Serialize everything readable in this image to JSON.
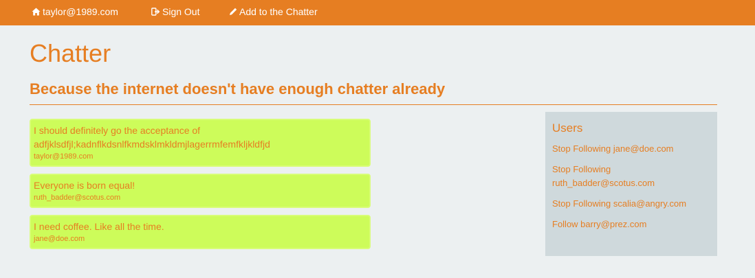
{
  "nav": {
    "home_label": "taylor@1989.com",
    "home_icon": "home-icon",
    "signout_label": "Sign Out",
    "signout_icon": "sign-out-icon",
    "add_label": "Add to the Chatter",
    "add_icon": "pencil-icon",
    "background_color": "#e67e22"
  },
  "header": {
    "title": "Chatter",
    "subtitle": "Because the internet doesn't have enough chatter already"
  },
  "chatters": [
    {
      "text": "I should definitely go the acceptance of adfjklsdfjl;kadnflkdsnlfkmdsklmkldmjlagerrmfemfkljkldfjd",
      "author": "taylor@1989.com"
    },
    {
      "text": "Everyone is born equal!",
      "author": "ruth_badder@scotus.com"
    },
    {
      "text": "I need coffee. Like all the time.",
      "author": "jane@doe.com"
    }
  ],
  "users_panel": {
    "title": "Users",
    "links": [
      {
        "label": "Stop Following jane@doe.com"
      },
      {
        "label": "Stop Following ruth_badder@scotus.com"
      },
      {
        "label": "Stop Following scalia@angry.com"
      },
      {
        "label": "Follow barry@prez.com"
      }
    ]
  },
  "colors": {
    "accent": "#e67e22",
    "card_background": "#cdfc5a",
    "panel_background": "#cfd9dc",
    "page_background": "#ecf0f1"
  }
}
